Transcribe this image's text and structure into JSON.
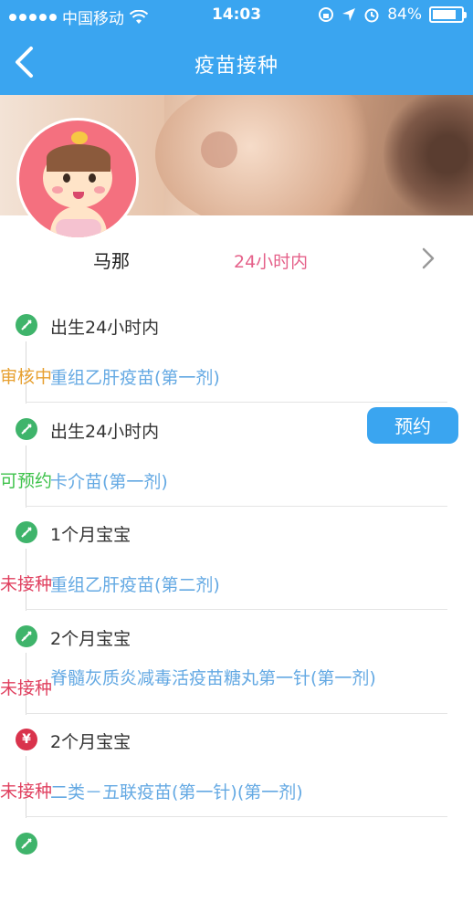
{
  "status_bar": {
    "carrier": "中国移动",
    "time": "14:03",
    "battery": "84%",
    "battery_level": 0.84
  },
  "nav": {
    "title": "疫苗接种",
    "back_icon": "chevron-left-icon"
  },
  "profile": {
    "name": "马那",
    "age_text": "24小时内",
    "more_icon": "chevron-right-icon"
  },
  "vaccines": [
    {
      "stage": "出生24小时内",
      "name": "重组乙肝疫苗(第一剂)",
      "status": "审核中",
      "status_color": "#e7a030",
      "icon": "vaccine-free-icon",
      "icon_color": "#3fb46b"
    },
    {
      "stage": "出生24小时内",
      "name": "卡介苗(第一剂)",
      "status": "可预约",
      "status_color": "#3dc24a",
      "icon": "vaccine-free-icon",
      "icon_color": "#3fb46b",
      "book_label": "预约"
    },
    {
      "stage": "1个月宝宝",
      "name": "重组乙肝疫苗(第二剂)",
      "status": "未接种",
      "status_color": "#e0405f",
      "icon": "vaccine-free-icon",
      "icon_color": "#3fb46b"
    },
    {
      "stage": "2个月宝宝",
      "name": "脊髓灰质炎减毒活疫苗糖丸第一针(第一剂)",
      "status": "未接种",
      "status_color": "#e0405f",
      "icon": "vaccine-free-icon",
      "icon_color": "#3fb46b"
    },
    {
      "stage": "2个月宝宝",
      "name": "二类－五联疫苗(第一针)(第一剂)",
      "status": "未接种",
      "status_color": "#e0405f",
      "icon": "vaccine-paid-icon",
      "icon_color": "#d9334c",
      "icon_glyph": "¥"
    }
  ],
  "colors": {
    "accent": "#3aa5f0",
    "vaccine_text": "#64a9e3",
    "age_text": "#e5618a"
  }
}
